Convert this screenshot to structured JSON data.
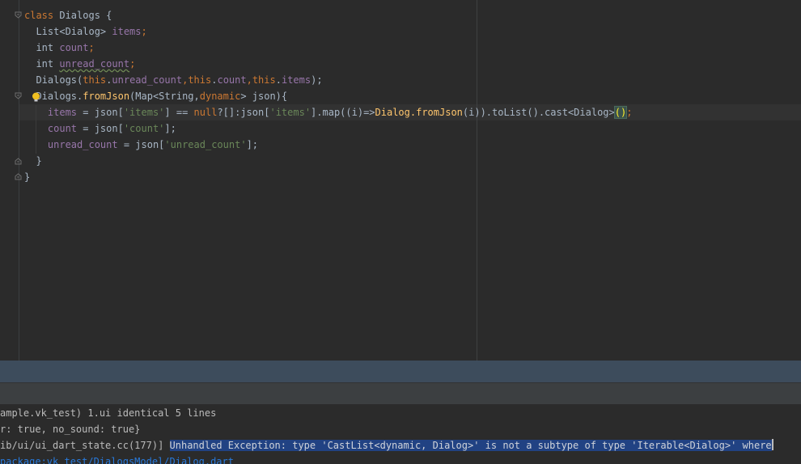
{
  "editor": {
    "lines": [
      {
        "parts": [
          {
            "t": "class",
            "c": "kw"
          },
          {
            "t": " Dialogs {",
            "c": ""
          }
        ]
      },
      {
        "parts": [
          {
            "t": "  List<Dialog> ",
            "c": ""
          },
          {
            "t": "items",
            "c": "fld"
          },
          {
            "t": ";",
            "c": "kw"
          }
        ]
      },
      {
        "parts": [
          {
            "t": "  int ",
            "c": ""
          },
          {
            "t": "count",
            "c": "fld"
          },
          {
            "t": ";",
            "c": "kw"
          }
        ]
      },
      {
        "parts": [
          {
            "t": "  int ",
            "c": ""
          },
          {
            "t": "unread_count",
            "c": "fld typo"
          },
          {
            "t": ";",
            "c": "kw"
          }
        ]
      },
      {
        "parts": [
          {
            "t": "  Dialogs(",
            "c": ""
          },
          {
            "t": "this",
            "c": "kw"
          },
          {
            "t": ".",
            "c": ""
          },
          {
            "t": "unread_count",
            "c": "fld"
          },
          {
            "t": ",",
            "c": "kw"
          },
          {
            "t": "this",
            "c": "kw"
          },
          {
            "t": ".",
            "c": ""
          },
          {
            "t": "count",
            "c": "fld"
          },
          {
            "t": ",",
            "c": "kw"
          },
          {
            "t": "this",
            "c": "kw"
          },
          {
            "t": ".",
            "c": ""
          },
          {
            "t": "items",
            "c": "fld"
          },
          {
            "t": ");",
            "c": ""
          }
        ]
      },
      {
        "parts": [
          {
            "t": "  Dialogs.",
            "c": ""
          },
          {
            "t": "fromJson",
            "c": "fn"
          },
          {
            "t": "(Map<String,",
            "c": ""
          },
          {
            "t": "dynamic",
            "c": "kw"
          },
          {
            "t": "> json){",
            "c": ""
          }
        ]
      },
      {
        "parts": [
          {
            "t": "    ",
            "c": ""
          },
          {
            "t": "items",
            "c": "fld"
          },
          {
            "t": " = json[",
            "c": ""
          },
          {
            "t": "'items'",
            "c": "str"
          },
          {
            "t": "] == ",
            "c": ""
          },
          {
            "t": "null",
            "c": "kw"
          },
          {
            "t": "?[]:json[",
            "c": ""
          },
          {
            "t": "'items'",
            "c": "str"
          },
          {
            "t": "].map((i)=>",
            "c": ""
          },
          {
            "t": "Dialog.",
            "c": "fn"
          },
          {
            "t": "fromJson",
            "c": "fn"
          },
          {
            "t": "(i)).toList().cast<Dialog>",
            "c": ""
          },
          {
            "t": "()",
            "c": "paren-match"
          },
          {
            "t": ";",
            "c": "kw"
          }
        ]
      },
      {
        "parts": [
          {
            "t": "    ",
            "c": ""
          },
          {
            "t": "count",
            "c": "fld"
          },
          {
            "t": " = json[",
            "c": ""
          },
          {
            "t": "'count'",
            "c": "str"
          },
          {
            "t": "];",
            "c": ""
          }
        ]
      },
      {
        "parts": [
          {
            "t": "    ",
            "c": ""
          },
          {
            "t": "unread_count",
            "c": "fld"
          },
          {
            "t": " = json[",
            "c": ""
          },
          {
            "t": "'unread_count'",
            "c": "str"
          },
          {
            "t": "];",
            "c": ""
          }
        ]
      },
      {
        "parts": [
          {
            "t": "  }",
            "c": ""
          }
        ]
      },
      {
        "parts": [
          {
            "t": "}",
            "c": ""
          }
        ]
      }
    ]
  },
  "console": {
    "lines": [
      {
        "parts": [
          {
            "t": "ample.vk_test) 1.ui identical 5 lines",
            "c": ""
          }
        ]
      },
      {
        "parts": [
          {
            "t": "r: true, no_sound: true}",
            "c": ""
          }
        ]
      },
      {
        "parts": [
          {
            "t": "ib/ui/ui_dart_state.cc(177)] ",
            "c": ""
          },
          {
            "t": "Unhandled Exception: type 'CastList<dynamic, Dialog>' is not a subtype of type 'Iterable<Dialog>' where",
            "c": "sel"
          }
        ]
      },
      {
        "parts": [
          {
            "t": "package:vk_test/DialogsModel/Dialog.dart",
            "c": "link"
          }
        ]
      }
    ]
  },
  "colors": {
    "editor_bg": "#2b2b2b",
    "keyword": "#cc7832",
    "field": "#9876aa",
    "string": "#6a8759",
    "function": "#ffc66d",
    "selection": "#214283",
    "panel_header": "#3d4c5c"
  },
  "icons": [
    "fold-marker-icon",
    "intention-bulb-icon"
  ]
}
